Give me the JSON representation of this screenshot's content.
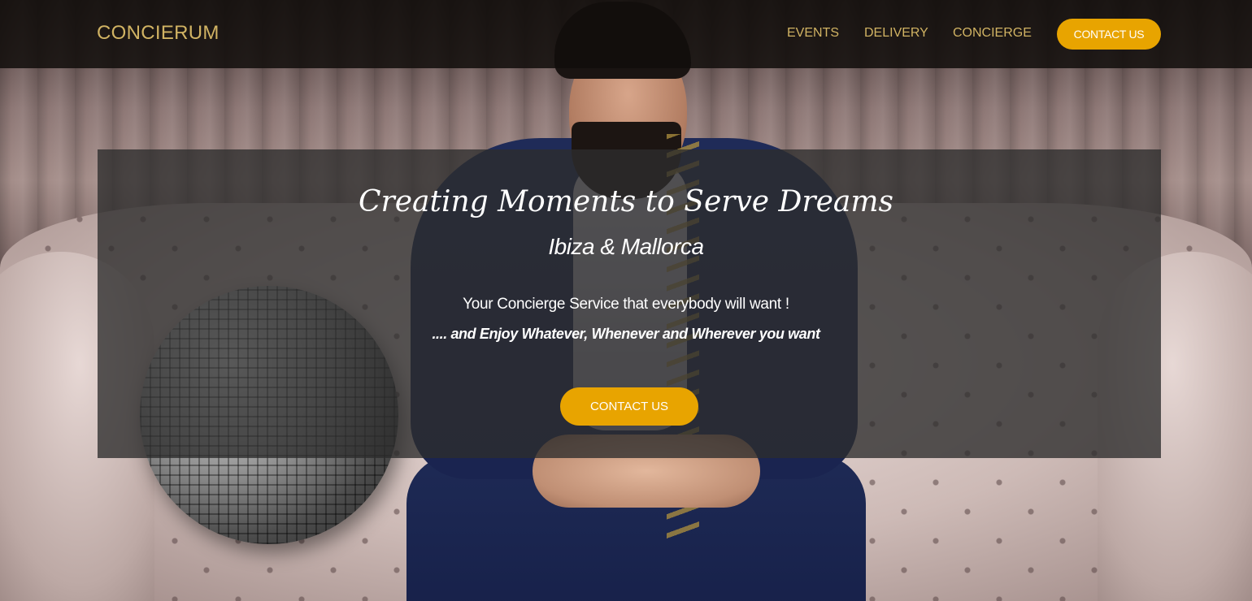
{
  "brand": {
    "name": "CONCIERUM"
  },
  "nav": {
    "events": "EVENTS",
    "delivery": "DELIVERY",
    "concierge": "CONCIERGE",
    "contact": "CONTACT US"
  },
  "hero": {
    "title": "Creating Moments to Serve Dreams",
    "subtitle": "Ibiza & Mallorca",
    "tagline": "Your Concierge Service that everybody will want !",
    "enjoy": ".... and Enjoy Whatever, Whenever and Wherever you want",
    "cta": "CONTACT US"
  },
  "colors": {
    "accent": "#e8a400",
    "brand_gold": "#d1b363",
    "nav_bg": "#120e0c",
    "overlay": "#2d2d2d"
  }
}
